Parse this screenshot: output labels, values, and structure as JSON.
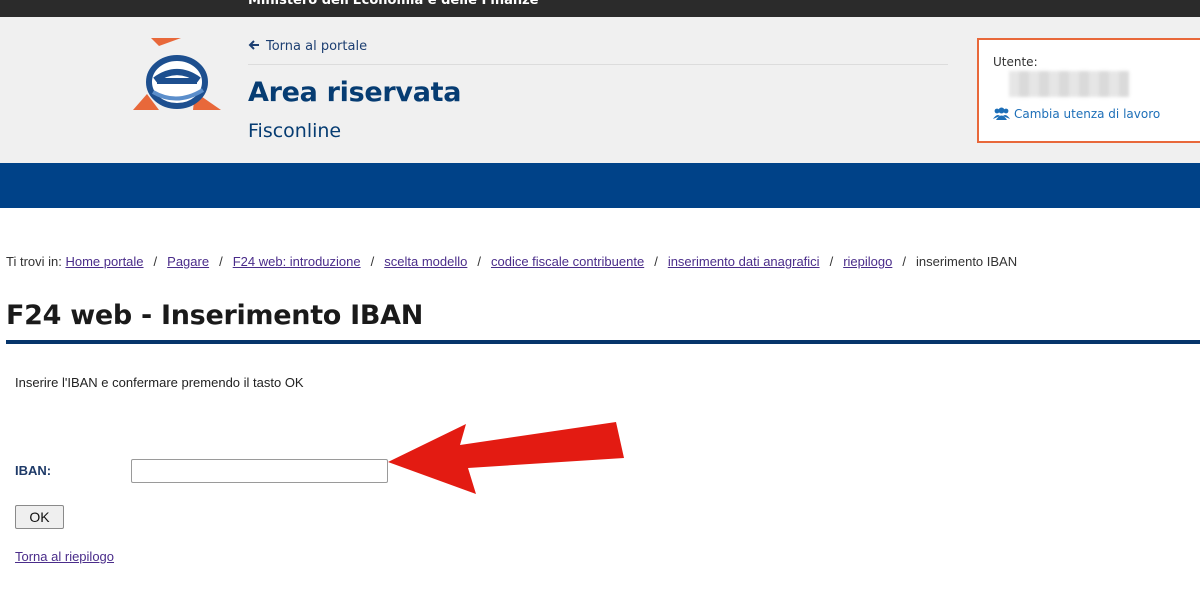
{
  "topbar": {
    "text": "Ministero dell'Economia e delle Finanze"
  },
  "header": {
    "back_link": "Torna al portale",
    "title": "Area riservata",
    "subtitle": "Fisconline",
    "logo_icon": "agenzia-entrate-logo"
  },
  "user": {
    "label": "Utente:",
    "change_link": "Cambia utenza di lavoro",
    "change_icon": "users-icon"
  },
  "colors": {
    "brand_blue": "#004288",
    "title_blue": "#063c72",
    "accent_orange": "#e8683a",
    "annotation_red": "#e31b12"
  },
  "breadcrumb": {
    "prefix": "Ti trovi in:",
    "items": [
      "Home portale",
      "Pagare",
      "F24 web: introduzione",
      "scelta modello",
      "codice fiscale contribuente",
      "inserimento dati anagrafici",
      "riepilogo"
    ],
    "separator": "/",
    "current": "inserimento IBAN"
  },
  "main": {
    "title": "F24 web - Inserimento IBAN",
    "instruction": "Inserire l'IBAN e confermare premendo il tasto OK",
    "iban_label": "IBAN:",
    "iban_value": "",
    "ok_label": "OK",
    "back_link": "Torna al riepilogo"
  }
}
